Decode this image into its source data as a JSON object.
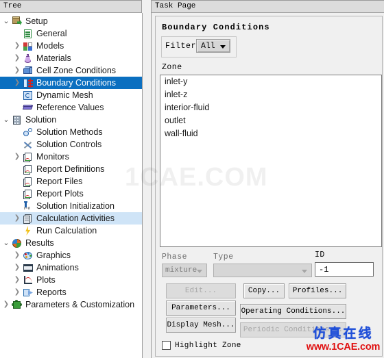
{
  "panels": {
    "tree_header": "Tree",
    "task_header": "Task Page"
  },
  "tree": {
    "items": [
      {
        "label": "Setup",
        "icon": "setup-icon",
        "level": 0,
        "twisty": "open",
        "state": "normal"
      },
      {
        "label": "General",
        "icon": "general-icon",
        "level": 1,
        "twisty": "none",
        "state": "normal"
      },
      {
        "label": "Models",
        "icon": "models-icon",
        "level": 1,
        "twisty": "closed",
        "state": "normal"
      },
      {
        "label": "Materials",
        "icon": "materials-icon",
        "level": 1,
        "twisty": "closed",
        "state": "normal"
      },
      {
        "label": "Cell Zone Conditions",
        "icon": "cell-zone-icon",
        "level": 1,
        "twisty": "closed",
        "state": "normal"
      },
      {
        "label": "Boundary Conditions",
        "icon": "boundary-conditions-icon",
        "level": 1,
        "twisty": "closed",
        "state": "selected"
      },
      {
        "label": "Dynamic Mesh",
        "icon": "dynamic-mesh-icon",
        "level": 1,
        "twisty": "none",
        "state": "normal"
      },
      {
        "label": "Reference Values",
        "icon": "reference-values-icon",
        "level": 1,
        "twisty": "none",
        "state": "normal"
      },
      {
        "label": "Solution",
        "icon": "solution-icon",
        "level": 0,
        "twisty": "open",
        "state": "normal"
      },
      {
        "label": "Solution Methods",
        "icon": "solution-methods-icon",
        "level": 1,
        "twisty": "none",
        "state": "normal"
      },
      {
        "label": "Solution Controls",
        "icon": "solution-controls-icon",
        "level": 1,
        "twisty": "none",
        "state": "normal"
      },
      {
        "label": "Monitors",
        "icon": "monitors-icon",
        "level": 1,
        "twisty": "closed",
        "state": "normal"
      },
      {
        "label": "Report Definitions",
        "icon": "report-definitions-icon",
        "level": 1,
        "twisty": "none",
        "state": "normal"
      },
      {
        "label": "Report Files",
        "icon": "report-files-icon",
        "level": 1,
        "twisty": "none",
        "state": "normal"
      },
      {
        "label": "Report Plots",
        "icon": "report-plots-icon",
        "level": 1,
        "twisty": "none",
        "state": "normal"
      },
      {
        "label": "Solution Initialization",
        "icon": "solution-initialization-icon",
        "level": 1,
        "twisty": "none",
        "state": "normal"
      },
      {
        "label": "Calculation Activities",
        "icon": "calculation-activities-icon",
        "level": 1,
        "twisty": "closed",
        "state": "highlighted"
      },
      {
        "label": "Run Calculation",
        "icon": "run-calculation-icon",
        "level": 1,
        "twisty": "none",
        "state": "normal"
      },
      {
        "label": "Results",
        "icon": "results-icon",
        "level": 0,
        "twisty": "open",
        "state": "normal"
      },
      {
        "label": "Graphics",
        "icon": "graphics-icon",
        "level": 1,
        "twisty": "closed",
        "state": "normal"
      },
      {
        "label": "Animations",
        "icon": "animations-icon",
        "level": 1,
        "twisty": "closed",
        "state": "normal"
      },
      {
        "label": "Plots",
        "icon": "plots-icon",
        "level": 1,
        "twisty": "closed",
        "state": "normal"
      },
      {
        "label": "Reports",
        "icon": "reports-icon",
        "level": 1,
        "twisty": "closed",
        "state": "normal"
      },
      {
        "label": "Parameters & Customization",
        "icon": "parameters-icon",
        "level": 0,
        "twisty": "closed",
        "state": "normal"
      }
    ],
    "twisty_open_glyph": "⌄",
    "twisty_closed_glyph": "❯"
  },
  "task": {
    "title": "Boundary Conditions",
    "filter": {
      "label": "Filter",
      "value": "All",
      "options": [
        "All"
      ]
    },
    "zone": {
      "label": "Zone",
      "items": [
        "inlet-y",
        "inlet-z",
        "interior-fluid",
        "outlet",
        "wall-fluid"
      ]
    },
    "phase": {
      "label": "Phase",
      "value": "mixture",
      "options": [
        "mixture"
      ]
    },
    "type": {
      "label": "Type",
      "value": "",
      "options": []
    },
    "id": {
      "label": "ID",
      "value": "-1"
    },
    "buttons": {
      "edit": "Edit...",
      "parameters": "Parameters...",
      "display_mesh": "Display Mesh...",
      "copy": "Copy...",
      "profiles": "Profiles...",
      "operating_conditions": "Operating Conditions...",
      "periodic_conditions": "Periodic Conditions..."
    },
    "highlight_zone": {
      "label": "Highlight Zone",
      "checked": false
    }
  },
  "watermarks": {
    "center": "1CAE.COM",
    "corner_cn": "仿真在线",
    "corner_url": "www.1CAE.com"
  },
  "colors": {
    "selection": "#0b6fc0",
    "highlight": "#cfe4f7",
    "panel_bg": "#f0f0f0",
    "header_bg": "#dcdcdc",
    "watermark_blue": "#1f4fd8",
    "watermark_red": "#e01010"
  }
}
